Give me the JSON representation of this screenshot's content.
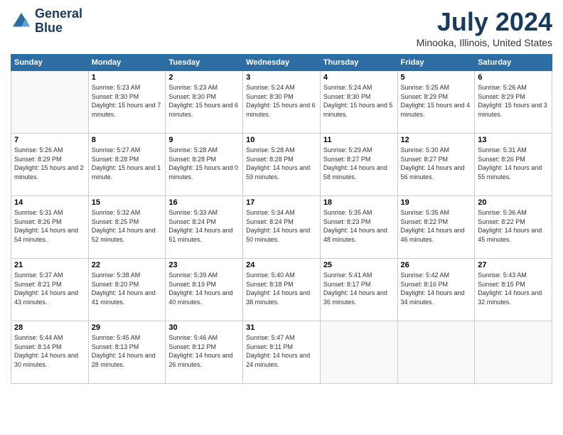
{
  "logo": {
    "line1": "General",
    "line2": "Blue"
  },
  "title": "July 2024",
  "location": "Minooka, Illinois, United States",
  "weekdays": [
    "Sunday",
    "Monday",
    "Tuesday",
    "Wednesday",
    "Thursday",
    "Friday",
    "Saturday"
  ],
  "weeks": [
    [
      {
        "day": "",
        "info": ""
      },
      {
        "day": "1",
        "info": "Sunrise: 5:23 AM\nSunset: 8:30 PM\nDaylight: 15 hours\nand 7 minutes."
      },
      {
        "day": "2",
        "info": "Sunrise: 5:23 AM\nSunset: 8:30 PM\nDaylight: 15 hours\nand 6 minutes."
      },
      {
        "day": "3",
        "info": "Sunrise: 5:24 AM\nSunset: 8:30 PM\nDaylight: 15 hours\nand 6 minutes."
      },
      {
        "day": "4",
        "info": "Sunrise: 5:24 AM\nSunset: 8:30 PM\nDaylight: 15 hours\nand 5 minutes."
      },
      {
        "day": "5",
        "info": "Sunrise: 5:25 AM\nSunset: 8:29 PM\nDaylight: 15 hours\nand 4 minutes."
      },
      {
        "day": "6",
        "info": "Sunrise: 5:26 AM\nSunset: 8:29 PM\nDaylight: 15 hours\nand 3 minutes."
      }
    ],
    [
      {
        "day": "7",
        "info": "Sunrise: 5:26 AM\nSunset: 8:29 PM\nDaylight: 15 hours\nand 2 minutes."
      },
      {
        "day": "8",
        "info": "Sunrise: 5:27 AM\nSunset: 8:28 PM\nDaylight: 15 hours\nand 1 minute."
      },
      {
        "day": "9",
        "info": "Sunrise: 5:28 AM\nSunset: 8:28 PM\nDaylight: 15 hours\nand 0 minutes."
      },
      {
        "day": "10",
        "info": "Sunrise: 5:28 AM\nSunset: 8:28 PM\nDaylight: 14 hours\nand 59 minutes."
      },
      {
        "day": "11",
        "info": "Sunrise: 5:29 AM\nSunset: 8:27 PM\nDaylight: 14 hours\nand 58 minutes."
      },
      {
        "day": "12",
        "info": "Sunrise: 5:30 AM\nSunset: 8:27 PM\nDaylight: 14 hours\nand 56 minutes."
      },
      {
        "day": "13",
        "info": "Sunrise: 5:31 AM\nSunset: 8:26 PM\nDaylight: 14 hours\nand 55 minutes."
      }
    ],
    [
      {
        "day": "14",
        "info": "Sunrise: 5:31 AM\nSunset: 8:26 PM\nDaylight: 14 hours\nand 54 minutes."
      },
      {
        "day": "15",
        "info": "Sunrise: 5:32 AM\nSunset: 8:25 PM\nDaylight: 14 hours\nand 52 minutes."
      },
      {
        "day": "16",
        "info": "Sunrise: 5:33 AM\nSunset: 8:24 PM\nDaylight: 14 hours\nand 51 minutes."
      },
      {
        "day": "17",
        "info": "Sunrise: 5:34 AM\nSunset: 8:24 PM\nDaylight: 14 hours\nand 50 minutes."
      },
      {
        "day": "18",
        "info": "Sunrise: 5:35 AM\nSunset: 8:23 PM\nDaylight: 14 hours\nand 48 minutes."
      },
      {
        "day": "19",
        "info": "Sunrise: 5:35 AM\nSunset: 8:22 PM\nDaylight: 14 hours\nand 46 minutes."
      },
      {
        "day": "20",
        "info": "Sunrise: 5:36 AM\nSunset: 8:22 PM\nDaylight: 14 hours\nand 45 minutes."
      }
    ],
    [
      {
        "day": "21",
        "info": "Sunrise: 5:37 AM\nSunset: 8:21 PM\nDaylight: 14 hours\nand 43 minutes."
      },
      {
        "day": "22",
        "info": "Sunrise: 5:38 AM\nSunset: 8:20 PM\nDaylight: 14 hours\nand 41 minutes."
      },
      {
        "day": "23",
        "info": "Sunrise: 5:39 AM\nSunset: 8:19 PM\nDaylight: 14 hours\nand 40 minutes."
      },
      {
        "day": "24",
        "info": "Sunrise: 5:40 AM\nSunset: 8:18 PM\nDaylight: 14 hours\nand 38 minutes."
      },
      {
        "day": "25",
        "info": "Sunrise: 5:41 AM\nSunset: 8:17 PM\nDaylight: 14 hours\nand 36 minutes."
      },
      {
        "day": "26",
        "info": "Sunrise: 5:42 AM\nSunset: 8:16 PM\nDaylight: 14 hours\nand 34 minutes."
      },
      {
        "day": "27",
        "info": "Sunrise: 5:43 AM\nSunset: 8:15 PM\nDaylight: 14 hours\nand 32 minutes."
      }
    ],
    [
      {
        "day": "28",
        "info": "Sunrise: 5:44 AM\nSunset: 8:14 PM\nDaylight: 14 hours\nand 30 minutes."
      },
      {
        "day": "29",
        "info": "Sunrise: 5:45 AM\nSunset: 8:13 PM\nDaylight: 14 hours\nand 28 minutes."
      },
      {
        "day": "30",
        "info": "Sunrise: 5:46 AM\nSunset: 8:12 PM\nDaylight: 14 hours\nand 26 minutes."
      },
      {
        "day": "31",
        "info": "Sunrise: 5:47 AM\nSunset: 8:11 PM\nDaylight: 14 hours\nand 24 minutes."
      },
      {
        "day": "",
        "info": ""
      },
      {
        "day": "",
        "info": ""
      },
      {
        "day": "",
        "info": ""
      }
    ]
  ]
}
